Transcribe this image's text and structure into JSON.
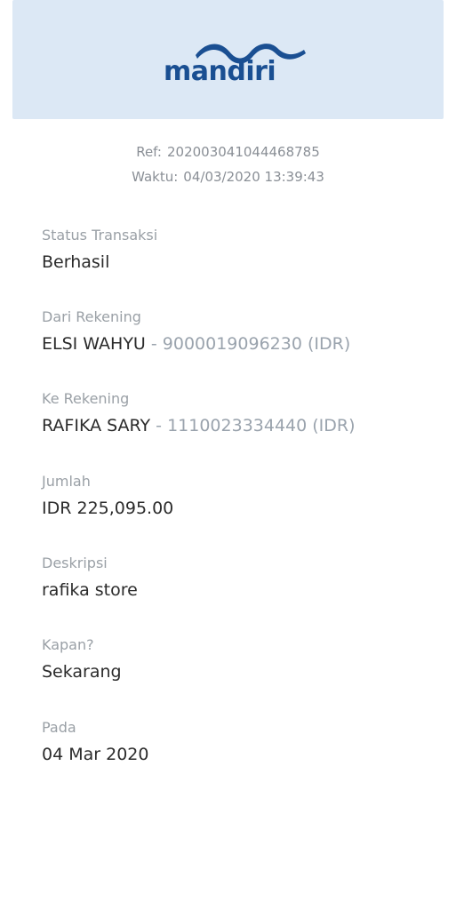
{
  "brand": {
    "name": "mandiri",
    "header_color": "#dce8f5",
    "logo_color": "#1a4f92"
  },
  "meta": {
    "ref_label": "Ref:",
    "ref_value": "202003041044468785",
    "time_label": "Waktu:",
    "time_value": "04/03/2020 13:39:43"
  },
  "fields": {
    "status": {
      "label": "Status Transaksi",
      "value": "Berhasil"
    },
    "from": {
      "label": "Dari Rekening",
      "name": "ELSI WAHYU",
      "sep": " - ",
      "account": "9000019096230 (IDR)"
    },
    "to": {
      "label": "Ke Rekening",
      "name": "RAFIKA SARY",
      "sep": " - ",
      "account": "1110023334440 (IDR)"
    },
    "amount": {
      "label": "Jumlah",
      "value": "IDR 225,095.00"
    },
    "description": {
      "label": "Deskripsi",
      "value": "rafika store"
    },
    "when": {
      "label": "Kapan?",
      "value": "Sekarang"
    },
    "date": {
      "label": "Pada",
      "value": "04 Mar 2020"
    }
  }
}
